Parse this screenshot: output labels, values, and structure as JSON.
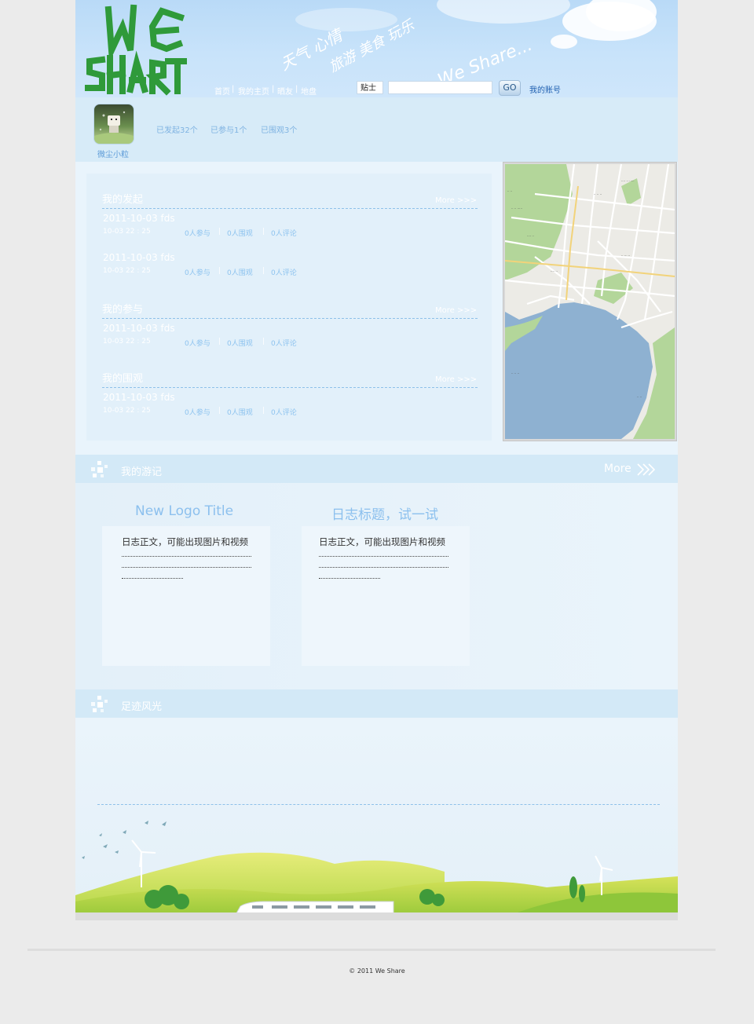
{
  "header": {
    "slogan_line1": "天气 心情",
    "slogan_line2": "旅游 美食 玩乐",
    "slogan_en": "We Share...",
    "nav": [
      "首页",
      "我的主页",
      "晒友",
      "地盘"
    ],
    "search_type": "贴士",
    "search_value": "",
    "go_label": "GO",
    "account_label": "我的账号"
  },
  "profile": {
    "name": "微尘小粒",
    "stats": [
      "已发起32个",
      "已参与1个",
      "已围观3个"
    ]
  },
  "activity": {
    "more_label": "More >>>",
    "sections": [
      {
        "title": "我的发起",
        "items": [
          {
            "title": "2011-10-03  fds",
            "time": "10-03  22 : 25",
            "join": "0人参与",
            "watch": "0人围观",
            "comment": "0人评论"
          },
          {
            "title": "2011-10-03  fds",
            "time": "10-03  22 : 25",
            "join": "0人参与",
            "watch": "0人围观",
            "comment": "0人评论"
          }
        ]
      },
      {
        "title": "我的参与",
        "items": [
          {
            "title": "2011-10-03  fds",
            "time": "10-03  22 : 25",
            "join": "0人参与",
            "watch": "0人围观",
            "comment": "0人评论"
          }
        ]
      },
      {
        "title": "我的围观",
        "items": [
          {
            "title": "2011-10-03  fds",
            "time": "10-03  22 : 25",
            "join": "0人参与",
            "watch": "0人围观",
            "comment": "0人评论"
          }
        ]
      }
    ]
  },
  "notes": {
    "title": "我的游记",
    "more_label": "More",
    "cards": [
      {
        "title": "New Logo Title",
        "body": "日志正文，可能出现图片和视频"
      },
      {
        "title": "日志标题，试一试",
        "body": "日志正文，可能出现图片和视频"
      }
    ]
  },
  "footprints": {
    "title": "足迹风光"
  },
  "footer": {
    "copyright": "© 2011 We Share"
  },
  "colors": {
    "accent": "#8cc0ee",
    "header_sky": "#c8e3fa",
    "grass": "#8fc73e",
    "map_water": "#8eb1d1",
    "map_land": "#a9d08f"
  },
  "icons": [
    "logo-graffiti",
    "band-square-icon",
    "more-chevron-icon",
    "map-image"
  ]
}
